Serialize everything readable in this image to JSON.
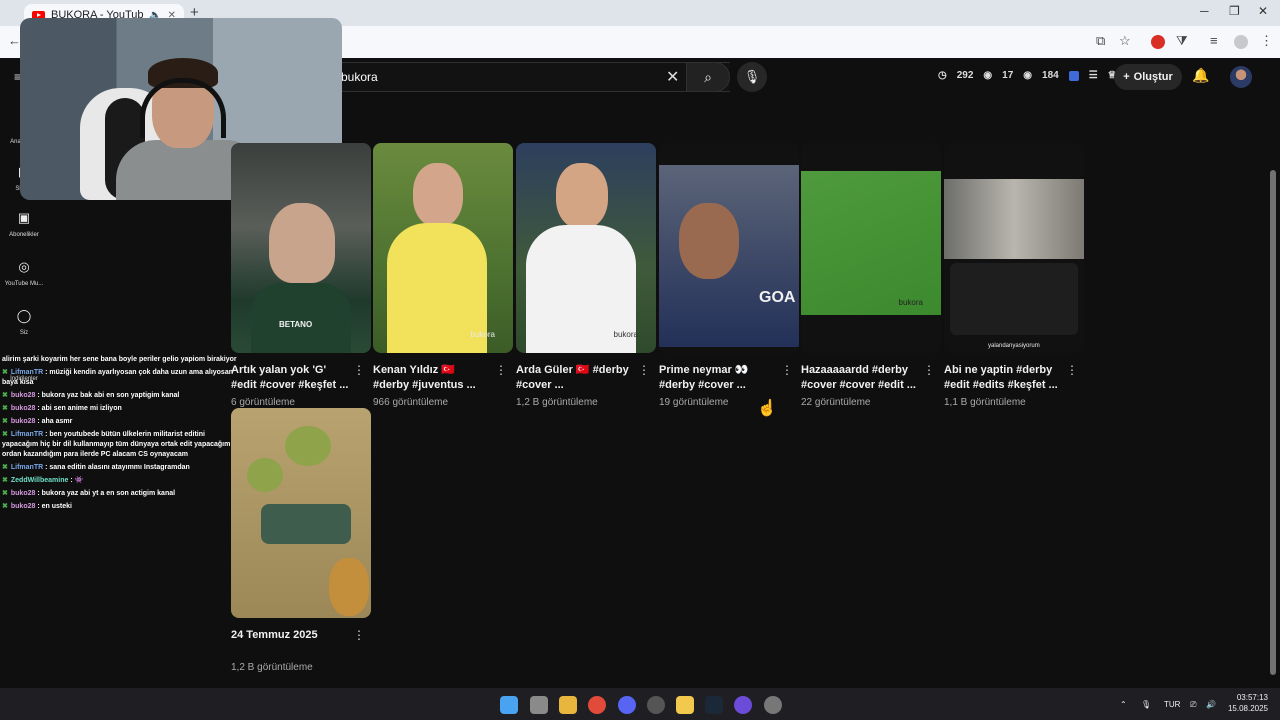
{
  "browser": {
    "tab_title": "BUKORA - YouTube",
    "new_tab": "+",
    "window_controls": [
      "─",
      "❐",
      "✕"
    ]
  },
  "header": {
    "search_value": "bukora",
    "stats": [
      "292",
      "17",
      "184"
    ],
    "create_label": "Oluştur"
  },
  "sidebar": {
    "items": [
      {
        "label": "Ana Sayfa",
        "icon": "home-icon"
      },
      {
        "label": "Shorts",
        "icon": "shorts-icon"
      },
      {
        "label": "Abonelikler",
        "icon": "subscriptions-icon"
      },
      {
        "label": "YouTube Mu...",
        "icon": "music-icon"
      },
      {
        "label": "Siz",
        "icon": "user-icon"
      },
      {
        "label": "İndirilenler",
        "icon": "download-icon"
      }
    ]
  },
  "chat": {
    "messages": [
      {
        "user": "",
        "text": "alirim şarki koyarim her sene bana boyle periler gelio yapiom birakiyor",
        "color": "white"
      },
      {
        "user": "LifmanTR",
        "text": ": müziği kendin ayarlıyosan çok daha uzun ama alıyosan baya kısa",
        "color": "blue"
      },
      {
        "user": "buko28",
        "text": ": bukora yaz bak abi en son yaptigim kanal",
        "color": "pink"
      },
      {
        "user": "buko28",
        "text": ": abi sen anime mi izliyon",
        "color": "pink"
      },
      {
        "user": "buko28",
        "text": ": aha asmr",
        "color": "pink"
      },
      {
        "user": "LifmanTR",
        "text": ": ben youtubede bütün ülkelerin militarist editini yapacağım hiç bir dil kullanmayıp tüm dünyaya ortak edit yapacağım ordan kazandığım para ilerde PC alacam CS oynayacam",
        "color": "blue"
      },
      {
        "user": "LifmanTR",
        "text": ": sana editin alasını atayımmı Instagramdan",
        "color": "blue"
      },
      {
        "user": "ZeddWillbeamine",
        "text": ": 👾",
        "color": "cyan"
      },
      {
        "user": "buko28",
        "text": ": bukora yaz abi yt a en son actigim kanal",
        "color": "pink"
      },
      {
        "user": "buko28",
        "text": ": en usteki",
        "color": "pink"
      }
    ]
  },
  "videos": [
    {
      "title": "Artık yalan yok 'G' #edit #cover #keşfet ...",
      "views": "6 görüntüleme",
      "watermark": ""
    },
    {
      "title": "Kenan Yıldız 🇹🇷 #derby #juventus ...",
      "views": "966 görüntüleme",
      "watermark": "bukora"
    },
    {
      "title": "Arda Güler 🇹🇷 #derby #cover ...",
      "views": "1,2 B görüntüleme",
      "watermark": "bukora"
    },
    {
      "title": "Prime neymar 👀 #derby #cover ...",
      "views": "19 görüntüleme",
      "watermark": ""
    },
    {
      "title": "Hazaaaaardd #derby #cover #cover #edit ...",
      "views": "22 görüntüleme",
      "watermark": "bukora"
    },
    {
      "title": "Abi ne yaptin #derby #edit #edits #keşfet ...",
      "views": "1,1 B görüntüleme",
      "watermark": "yalandanyasiyorum"
    },
    {
      "title": "24 Temmuz 2025",
      "views": "1,2 B görüntüleme",
      "watermark": ""
    }
  ],
  "taskbar": {
    "lang": "TUR",
    "time": "03:57:13",
    "date": "15.08.2025"
  }
}
